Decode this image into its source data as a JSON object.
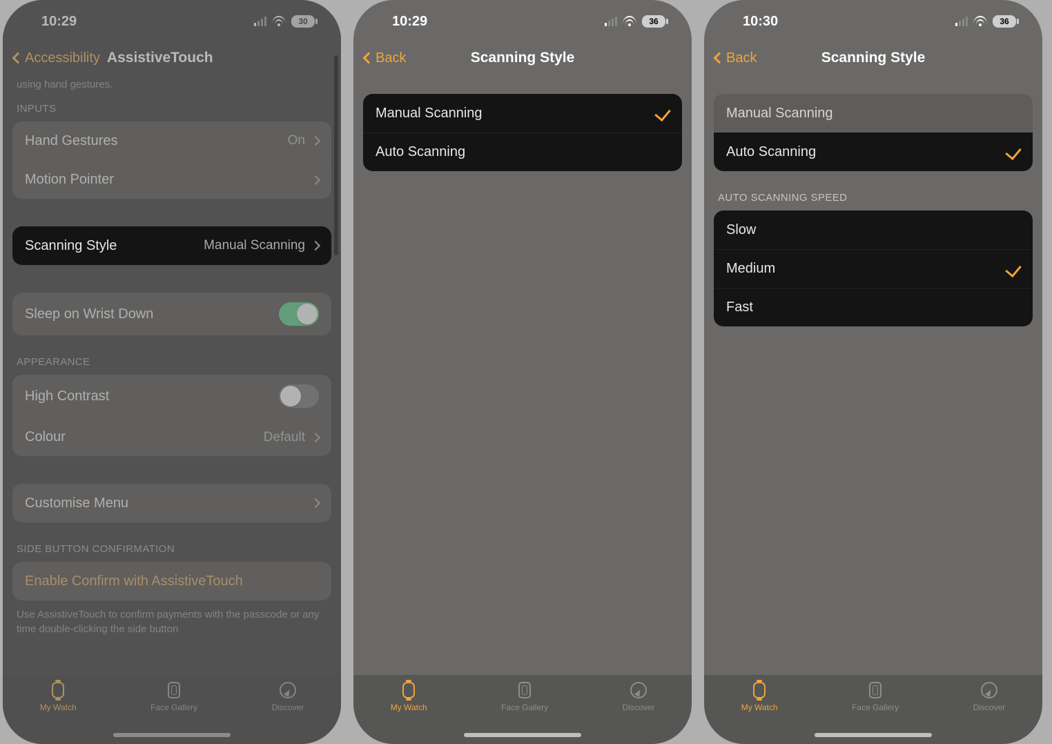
{
  "screens": {
    "a": {
      "time": "10:29",
      "battery": "30",
      "back_label": "Accessibility",
      "title": "AssistiveTouch",
      "note_top": "using hand gestures.",
      "section_inputs": "INPUTS",
      "hand_gestures_label": "Hand Gestures",
      "hand_gestures_value": "On",
      "motion_pointer_label": "Motion Pointer",
      "scanning_style_label": "Scanning Style",
      "scanning_style_value": "Manual Scanning",
      "sleep_label": "Sleep on Wrist Down",
      "section_appearance": "APPEARANCE",
      "high_contrast_label": "High Contrast",
      "colour_label": "Colour",
      "colour_value": "Default",
      "customise_label": "Customise Menu",
      "section_side_button": "SIDE BUTTON CONFIRMATION",
      "enable_confirm_label": "Enable Confirm with AssistiveTouch",
      "footnote": "Use AssistiveTouch to confirm payments with the passcode or any time double-clicking the side button"
    },
    "b": {
      "time": "10:29",
      "battery": "36",
      "back_label": "Back",
      "title": "Scanning Style",
      "options": [
        {
          "label": "Manual Scanning",
          "selected": true
        },
        {
          "label": "Auto Scanning",
          "selected": false
        }
      ]
    },
    "c": {
      "time": "10:30",
      "battery": "36",
      "back_label": "Back",
      "title": "Scanning Style",
      "options": [
        {
          "label": "Manual Scanning",
          "selected": false
        },
        {
          "label": "Auto Scanning",
          "selected": true
        }
      ],
      "section_speed": "AUTO SCANNING SPEED",
      "speeds": [
        {
          "label": "Slow",
          "selected": false
        },
        {
          "label": "Medium",
          "selected": true
        },
        {
          "label": "Fast",
          "selected": false
        }
      ]
    },
    "tabs": {
      "my_watch": "My Watch",
      "face_gallery": "Face Gallery",
      "discover": "Discover"
    }
  }
}
